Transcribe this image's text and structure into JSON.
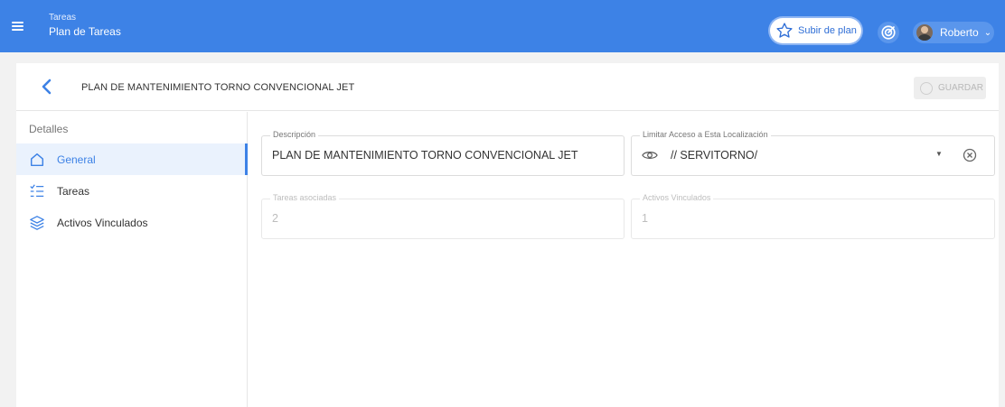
{
  "topbar": {
    "section": "Tareas",
    "title": "Plan de Tareas",
    "upgrade_label": "Subir de plan",
    "user_name": "Roberto",
    "menu_icon": "hamburger-icon",
    "upgrade_icon": "star-icon",
    "target_icon": "target-icon",
    "accent": "#3d82e6"
  },
  "header": {
    "title": "PLAN DE MANTENIMIENTO TORNO CONVENCIONAL JET",
    "save_label": "GUARDAR",
    "back_icon": "chevron-left-icon"
  },
  "sidebar": {
    "heading": "Detalles",
    "items": [
      {
        "label": "General",
        "icon": "home-icon",
        "active": true
      },
      {
        "label": "Tareas",
        "icon": "checklist-icon",
        "active": false
      },
      {
        "label": "Activos Vinculados",
        "icon": "layers-icon",
        "active": false
      }
    ]
  },
  "form": {
    "descripcion": {
      "label": "Descripción",
      "value": "PLAN DE MANTENIMIENTO TORNO CONVENCIONAL JET"
    },
    "localizacion": {
      "label": "Limitar Acceso a Esta Localización",
      "value": "// SERVITORNO/"
    },
    "tareas": {
      "label": "Tareas asociadas",
      "value": "2"
    },
    "activos": {
      "label": "Activos Vinculados",
      "value": "1"
    }
  }
}
